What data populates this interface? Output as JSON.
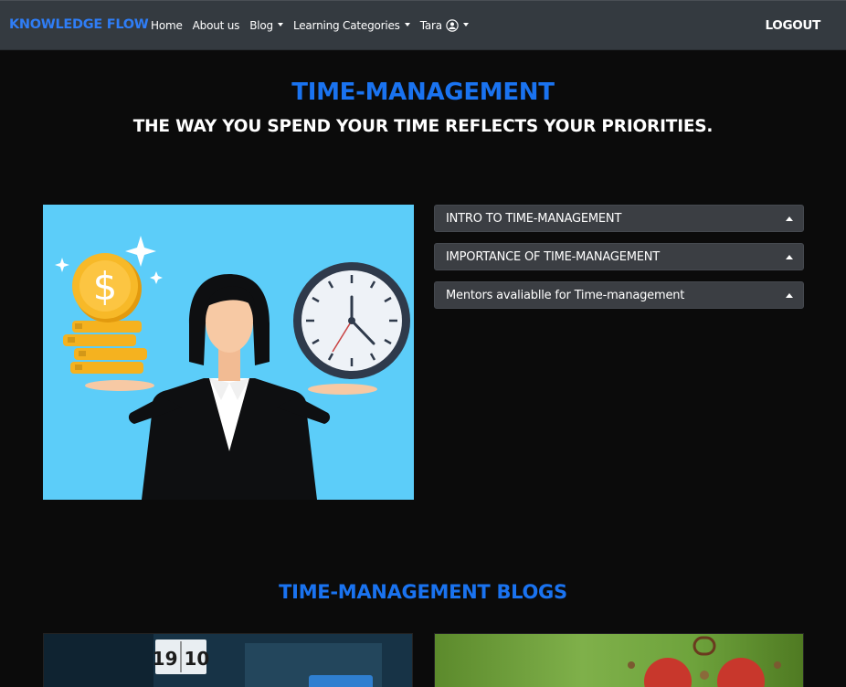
{
  "navbar": {
    "brand": "KNOWLEDGE FLOW",
    "items": [
      {
        "label": "Home",
        "dropdown": false
      },
      {
        "label": "About us",
        "dropdown": false
      },
      {
        "label": "Blog",
        "dropdown": true
      },
      {
        "label": "Learning Categories",
        "dropdown": true
      }
    ],
    "user": {
      "label": "Tara",
      "icon": "user-circle-icon"
    },
    "logout_label": "LOGOUT",
    "brand_color": "#2f7df6"
  },
  "hero": {
    "title": "TIME-MANAGEMENT",
    "subtitle": "THE WAY YOU SPEND YOUR TIME REFLECTS YOUR PRIORITIES.",
    "title_color": "#1a73f0"
  },
  "illustration": {
    "coin_label": "$",
    "description_icon": "time-management-illustration"
  },
  "accordion": {
    "items": [
      {
        "label": "INTRO TO TIME-MANAGEMENT"
      },
      {
        "label": "IMPORTANCE OF TIME-MANAGEMENT"
      },
      {
        "label": "Mentors avaliablle for Time-management"
      }
    ]
  },
  "blogs": {
    "title": "TIME-MANAGEMENT BLOGS",
    "clock_display": "19 10"
  }
}
